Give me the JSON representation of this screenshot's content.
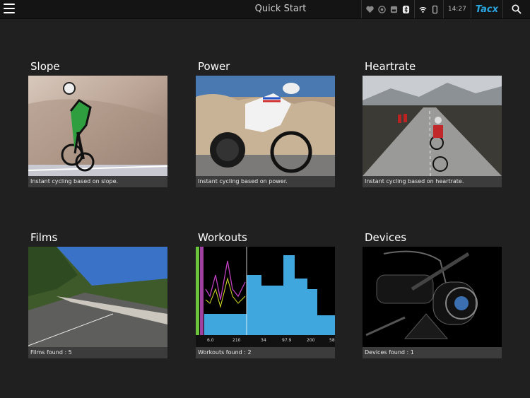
{
  "header": {
    "title": "Quick Start",
    "time": "14:27",
    "brand": "Tacx"
  },
  "tiles": [
    {
      "title": "Slope",
      "caption": "Instant cycling based on slope."
    },
    {
      "title": "Power",
      "caption": "Instant cycling based on power."
    },
    {
      "title": "Heartrate",
      "caption": "Instant cycling based on heartrate."
    },
    {
      "title": "Films",
      "caption": "Films found : 5"
    },
    {
      "title": "Workouts",
      "caption": "Workouts found : 2"
    },
    {
      "title": "Devices",
      "caption": "Devices found : 1"
    }
  ],
  "workout_readout": [
    "6.0",
    "210",
    "34",
    "97.9",
    "200",
    "58"
  ],
  "colors": {
    "accent": "#2aa5e0",
    "background": "#202020",
    "caption_bg": "#3c3c3c"
  }
}
